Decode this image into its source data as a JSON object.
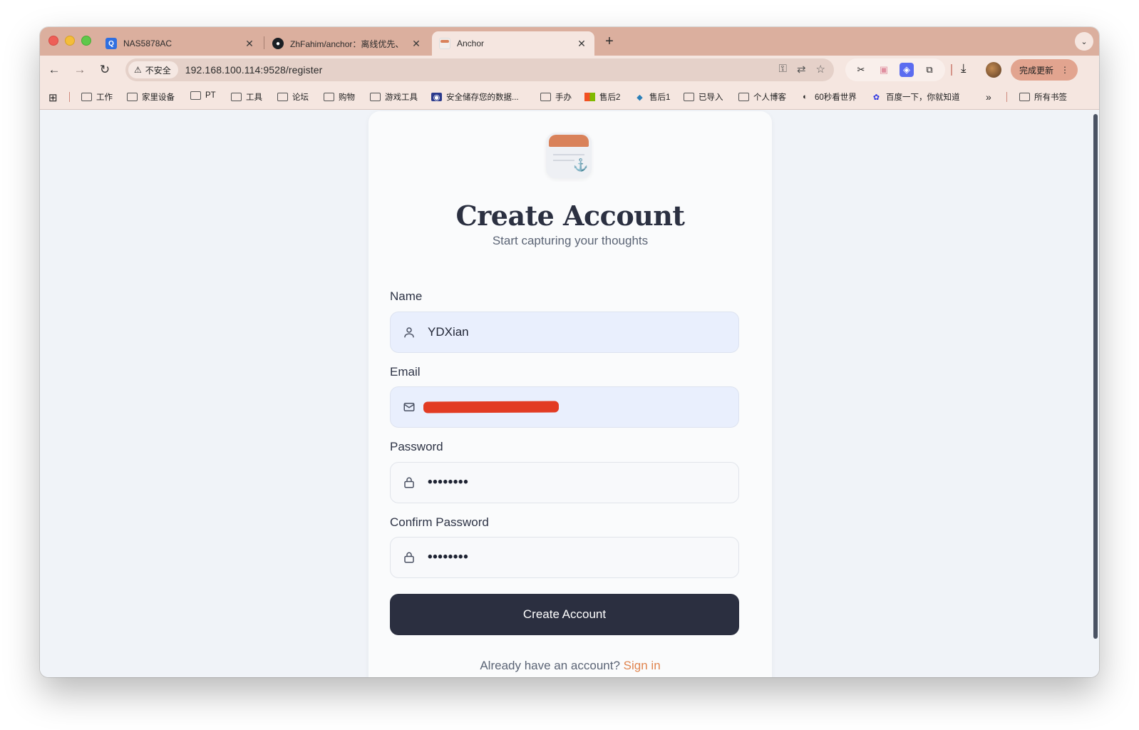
{
  "browser": {
    "tabs": [
      {
        "title": "NAS5878AC",
        "active": false
      },
      {
        "title": "ZhFahim/anchor：离线优先、",
        "active": false
      },
      {
        "title": "Anchor",
        "active": true
      }
    ],
    "address_bar": {
      "security_label": "不安全",
      "url": "192.168.100.114:9528/register"
    },
    "update_button_label": "完成更新",
    "bookmarks": [
      {
        "label": "工作",
        "icon": "folder-icon"
      },
      {
        "label": "家里设备",
        "icon": "folder-icon"
      },
      {
        "label": "PT",
        "icon": "folder-icon"
      },
      {
        "label": "工具",
        "icon": "folder-icon"
      },
      {
        "label": "论坛",
        "icon": "folder-icon"
      },
      {
        "label": "购物",
        "icon": "folder-icon"
      },
      {
        "label": "游戏工具",
        "icon": "folder-icon"
      },
      {
        "label": "安全储存您的数据...",
        "icon": "site-icon"
      },
      {
        "label": "手办",
        "icon": "folder-icon"
      },
      {
        "label": "售后2",
        "icon": "microsoft-icon"
      },
      {
        "label": "售后1",
        "icon": "site-icon"
      },
      {
        "label": "已导入",
        "icon": "folder-icon"
      },
      {
        "label": "个人博客",
        "icon": "folder-icon"
      },
      {
        "label": "60秒看世界",
        "icon": "site-icon"
      },
      {
        "label": "百度一下，你就知道",
        "icon": "baidu-icon"
      }
    ],
    "all_bookmarks_label": "所有书签",
    "colors": {
      "tab_strip": "#dbaf9e",
      "toolbar": "#f5e6e0"
    }
  },
  "page": {
    "heading": "Create Account",
    "subheading": "Start capturing your thoughts",
    "form": {
      "name": {
        "label": "Name",
        "value": "YDXian",
        "icon": "user-icon"
      },
      "email": {
        "label": "Email",
        "value": "[redacted]",
        "icon": "mail-icon"
      },
      "password": {
        "label": "Password",
        "value": "••••••••",
        "icon": "lock-icon"
      },
      "confirm_password": {
        "label": "Confirm Password",
        "value": "••••••••",
        "icon": "lock-icon"
      },
      "submit_label": "Create Account"
    },
    "footer": {
      "prompt": "Already have an account?",
      "link_label": "Sign in"
    },
    "colors": {
      "primary_button": "#2b2f40",
      "accent_link": "#e0844e",
      "logo_accent": "#d9825a"
    }
  }
}
